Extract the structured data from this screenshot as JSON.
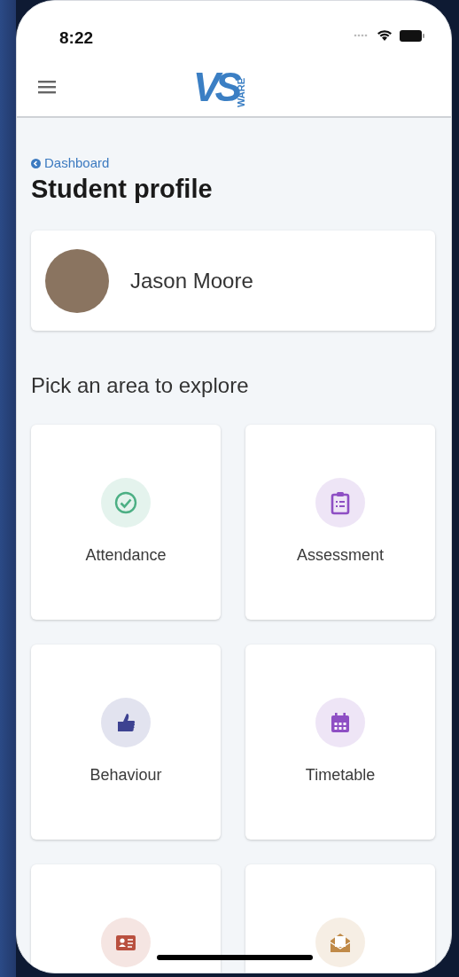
{
  "status_bar": {
    "time": "8:22"
  },
  "navbar": {
    "logo": {
      "mark": "VS",
      "suffix": "WARE"
    }
  },
  "breadcrumb": {
    "label": "Dashboard"
  },
  "title": "Student profile",
  "student": {
    "name": "Jason Moore"
  },
  "section_title": "Pick an area to explore",
  "areas": [
    {
      "kind": "check",
      "label": "Attendance",
      "color": "#4caf84"
    },
    {
      "kind": "clipboard",
      "label": "Assessment",
      "color": "#8e4fc4"
    },
    {
      "kind": "thumb",
      "label": "Behaviour",
      "color": "#3d4291"
    },
    {
      "kind": "calendar",
      "label": "Timetable",
      "color": "#8e4fc4"
    },
    {
      "kind": "idcard",
      "color": "#b9503f"
    },
    {
      "kind": "money",
      "color": "#c08a48"
    }
  ]
}
